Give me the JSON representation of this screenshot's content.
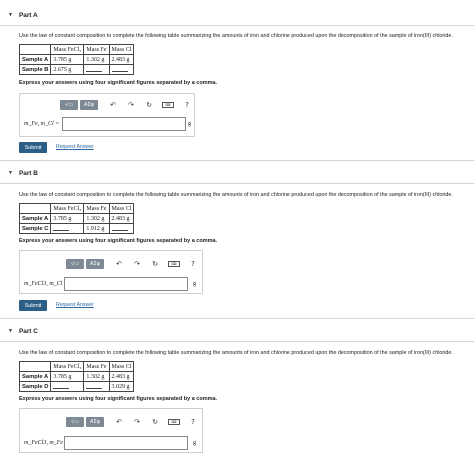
{
  "instructions": "Use the law of constant composition to complete the following table summarizing the amounts of iron and chlorine produced upon the decomposition of the sample of iron(III) chloride.",
  "express_text": "Express your answers using four significant figures separated by a comma.",
  "toolbar": {
    "template_label": "√▭",
    "greek_label": "ΑΣφ",
    "undo_glyph": "↶",
    "redo_glyph": "↷",
    "reset_glyph": "↻",
    "keyboard_label": "⌨",
    "help_glyph": "?"
  },
  "submit_label": "Submit",
  "request_label": "Request Answer",
  "unit": "g",
  "table_header": [
    "",
    "Mass FeCl₃",
    "Mass Fe",
    "Mass Cl"
  ],
  "parts": [
    {
      "title": "Part A",
      "rows": [
        {
          "label": "Sample A",
          "c1": "3.785 g",
          "c2": "1.302 g",
          "c3": "2.483 g"
        },
        {
          "label": "Sample B",
          "c1": "2.675 g",
          "c2": "",
          "c3": ""
        }
      ],
      "answer_label": "m_Fe, m_Cl ="
    },
    {
      "title": "Part B",
      "rows": [
        {
          "label": "Sample A",
          "c1": "3.785 g",
          "c2": "1.302 g",
          "c3": "2.483 g"
        },
        {
          "label": "Sample C",
          "c1": "",
          "c2": "1.912 g",
          "c3": ""
        }
      ],
      "answer_label": "m_FeCl3, m_Cl ="
    },
    {
      "title": "Part C",
      "rows": [
        {
          "label": "Sample A",
          "c1": "3.785 g",
          "c2": "1.302 g",
          "c3": "2.483 g"
        },
        {
          "label": "Sample D",
          "c1": "",
          "c2": "",
          "c3": "3.029 g"
        }
      ],
      "answer_label": "m_FeCl3, m_Fe ="
    }
  ]
}
